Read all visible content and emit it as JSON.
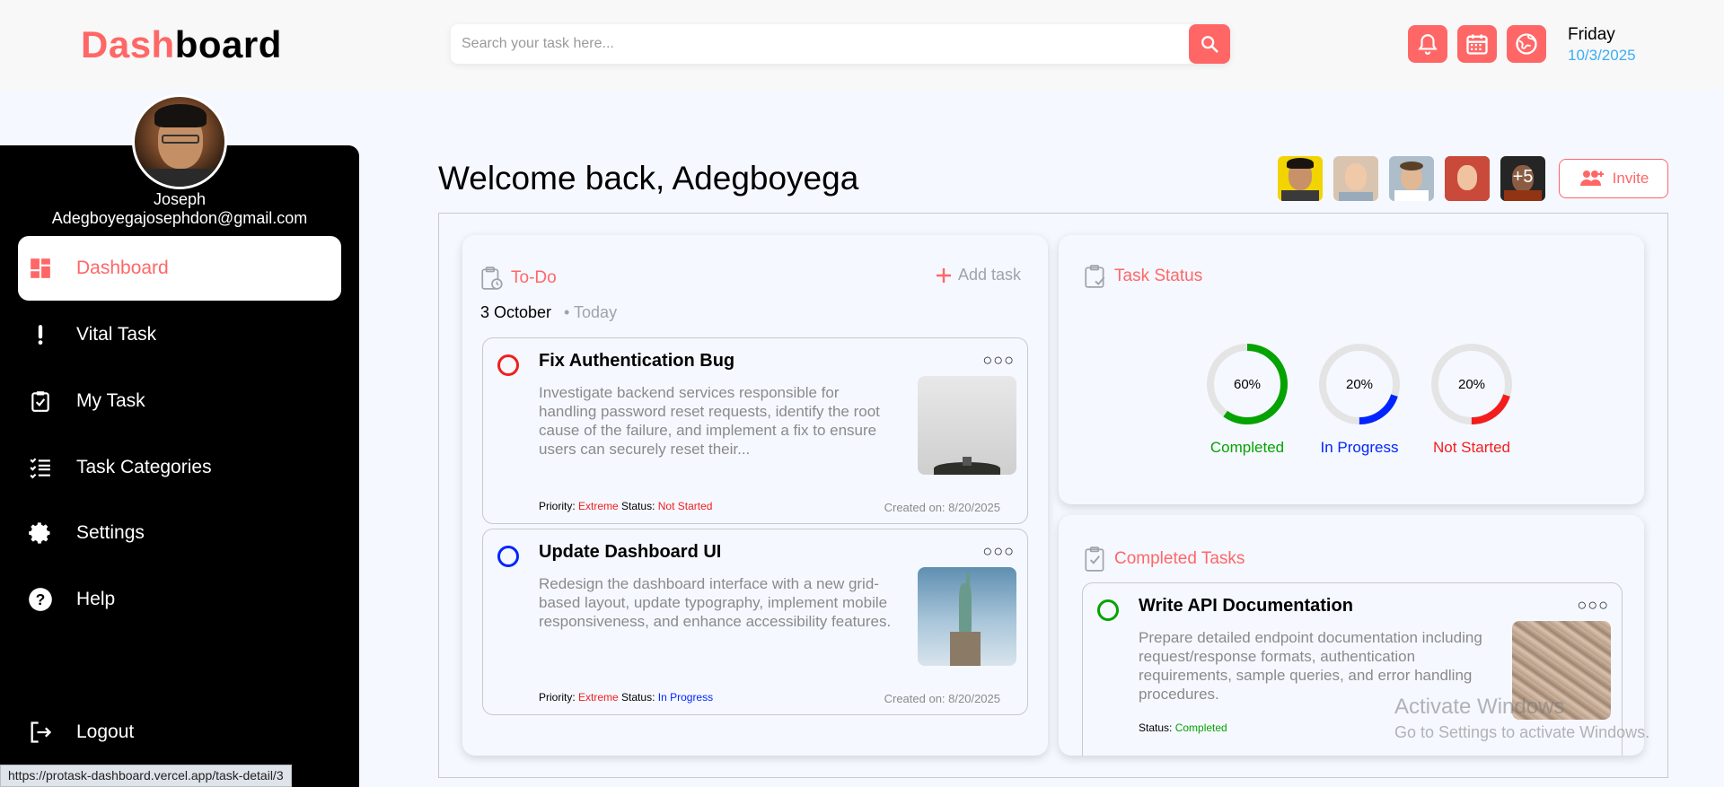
{
  "header": {
    "logo_accent": "Dash",
    "logo_rest": "board",
    "search_placeholder": "Search your task here...",
    "day": "Friday",
    "date": "10/3/2025",
    "icons": [
      "search-icon",
      "bell-icon",
      "calendar-icon",
      "globe-icon"
    ]
  },
  "user": {
    "name": "Joseph",
    "email": "Adegboyegajosephdon@gmail.com"
  },
  "sidebar": {
    "items": [
      {
        "label": "Dashboard",
        "icon": "dashboard-icon",
        "active": true
      },
      {
        "label": "Vital Task",
        "icon": "exclamation-icon",
        "active": false
      },
      {
        "label": "My Task",
        "icon": "checklist-icon",
        "active": false
      },
      {
        "label": "Task Categories",
        "icon": "list-icon",
        "active": false
      },
      {
        "label": "Settings",
        "icon": "gear-icon",
        "active": false
      },
      {
        "label": "Help",
        "icon": "help-icon",
        "active": false
      }
    ],
    "logout": "Logout"
  },
  "status_url": "https://protask-dashboard.vercel.app/task-detail/3",
  "main": {
    "welcome": "Welcome back, Adegboyega",
    "team_extra": "+5",
    "invite": "Invite"
  },
  "todo": {
    "title": "To-Do",
    "add_task": "Add task",
    "date": "3 October",
    "today": "Today",
    "tasks": [
      {
        "title": "Fix Authentication Bug",
        "description": "Investigate backend services responsible for handling password reset requests, identify the root cause of the failure, and implement a fix to ensure users can securely reset their...",
        "priority_label": "Priority:",
        "priority": "Extreme",
        "status_label": "Status:",
        "status": "Not Started",
        "created": "Created on: 8/20/2025",
        "circle_color": "#f21e1e"
      },
      {
        "title": "Update Dashboard UI",
        "description": "Redesign the dashboard interface with a new grid-based layout, update typography, implement mobile responsiveness, and enhance accessibility features.",
        "priority_label": "Priority:",
        "priority": "Extreme",
        "status_label": "Status:",
        "status": "In Progress",
        "created": "Created on: 8/20/2025",
        "circle_color": "#0225ff"
      }
    ]
  },
  "task_status": {
    "title": "Task Status",
    "items": [
      {
        "label": "Completed",
        "percent": "60%",
        "value": 60,
        "color": "#05a301"
      },
      {
        "label": "In Progress",
        "percent": "20%",
        "value": 20,
        "color": "#0225ff"
      },
      {
        "label": "Not Started",
        "percent": "20%",
        "value": 20,
        "color": "#f21e1e"
      }
    ]
  },
  "completed": {
    "title": "Completed Tasks",
    "tasks": [
      {
        "title": "Write API Documentation",
        "description": "Prepare detailed endpoint documentation including request/response formats, authentication requirements, sample queries, and error handling procedures.",
        "status_label": "Status:",
        "status": "Completed",
        "circle_color": "#05a301"
      }
    ]
  },
  "watermark": {
    "line1": "Activate Windows",
    "line2": "Go to Settings to activate Windows."
  }
}
